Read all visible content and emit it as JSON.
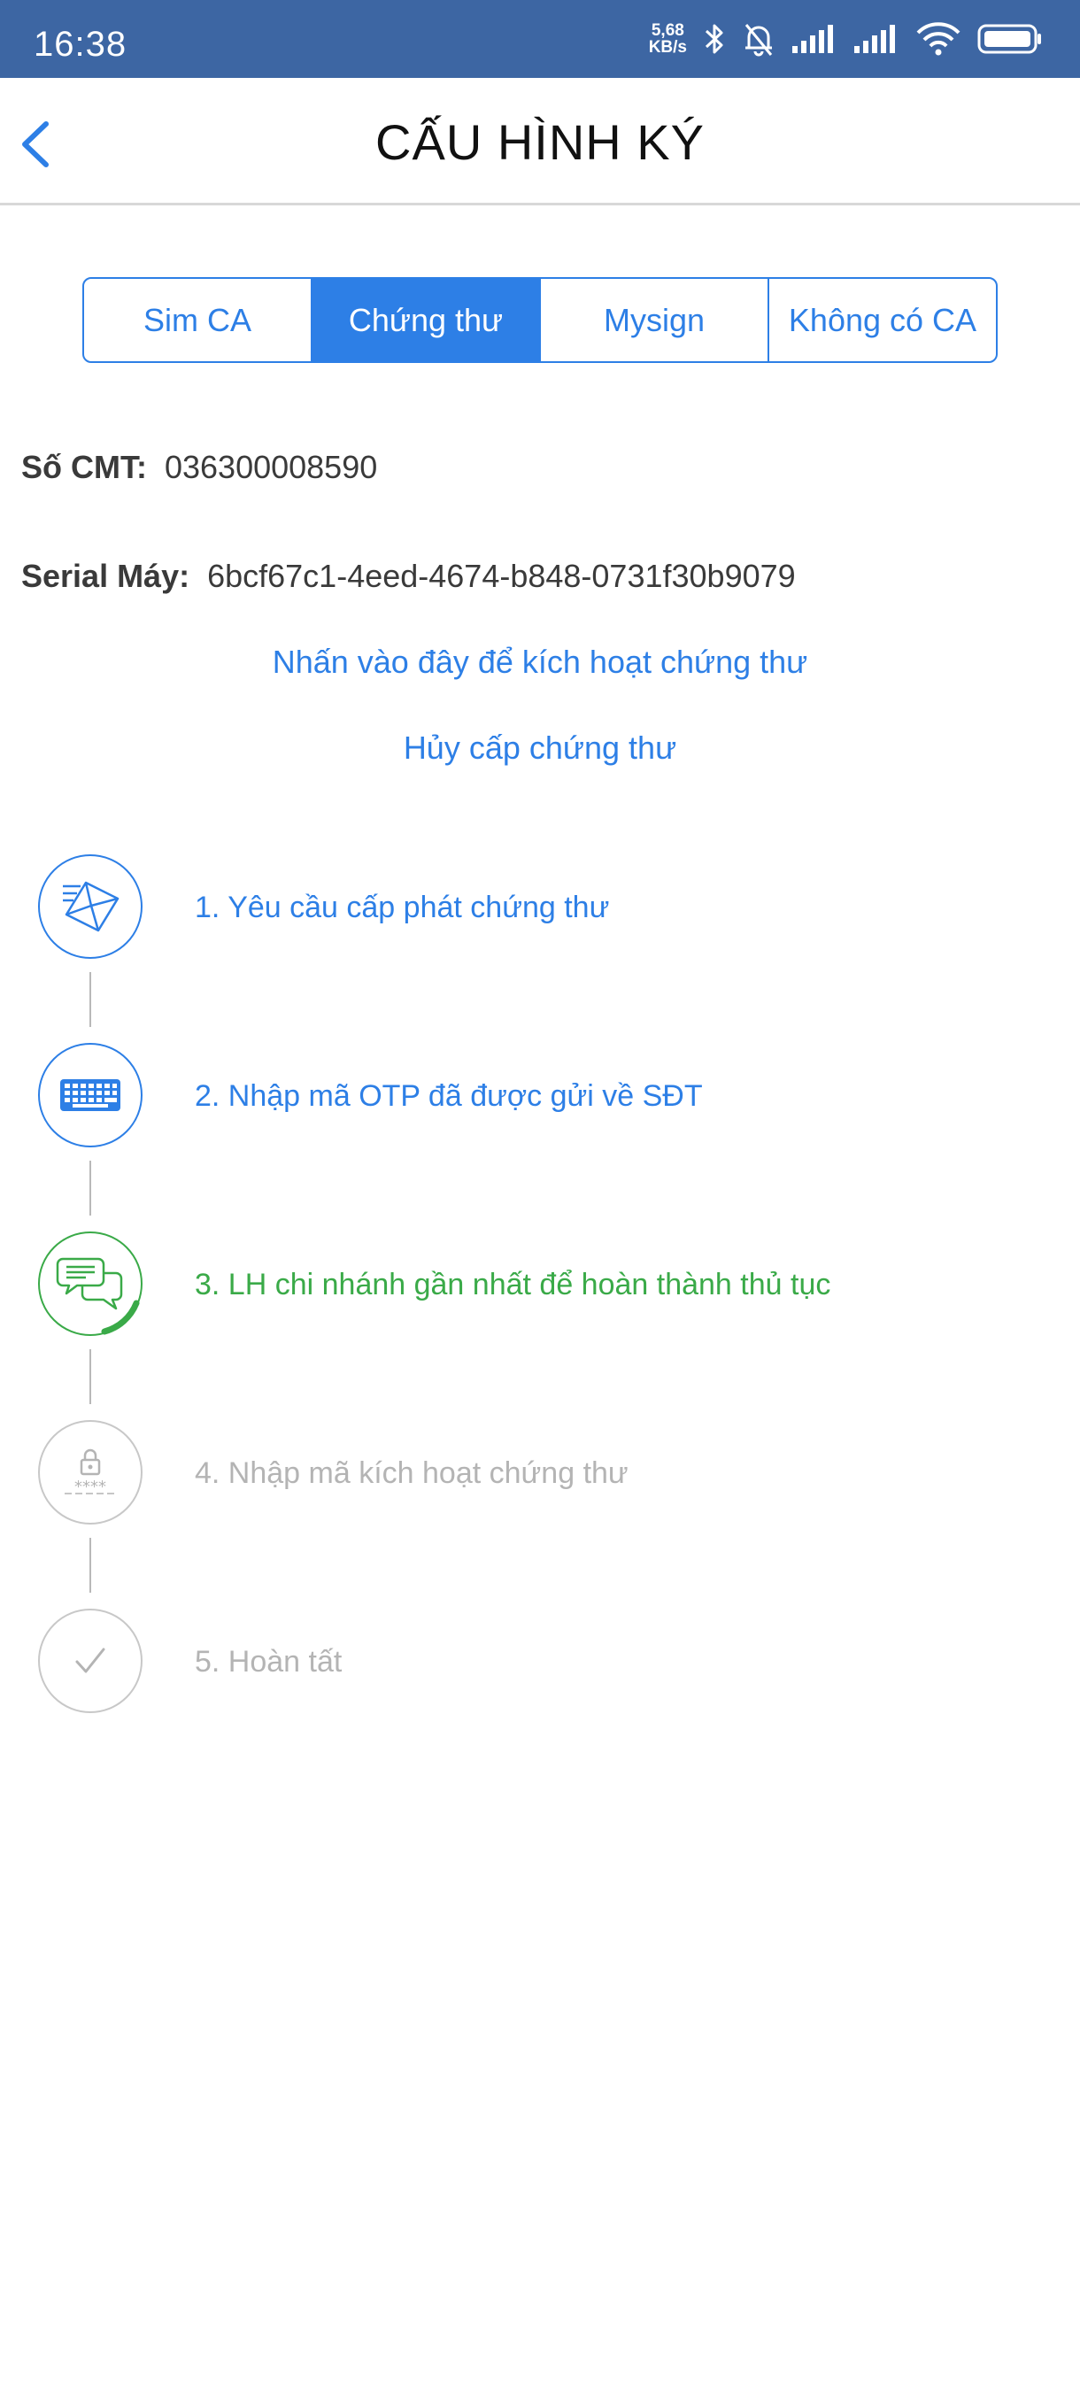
{
  "status_bar": {
    "time": "16:38",
    "net_speed_value": "5,68",
    "net_speed_unit": "KB/s",
    "icons": [
      "bluetooth-icon",
      "mute-bell-icon",
      "signal-icon",
      "signal-icon",
      "wifi-icon",
      "battery-icon"
    ]
  },
  "header": {
    "title": "CẤU HÌNH KÝ",
    "back_icon": "chevron-left-icon"
  },
  "tabs": [
    {
      "label": "Sim CA",
      "active": false
    },
    {
      "label": "Chứng thư",
      "active": true
    },
    {
      "label": "Mysign",
      "active": false
    },
    {
      "label": "Không có CA",
      "active": false
    }
  ],
  "info": {
    "cmt_label": "Số CMT:",
    "cmt_value": "036300008590",
    "serial_label": "Serial Máy:",
    "serial_value": "6bcf67c1-4eed-4674-b848-0731f30b9079"
  },
  "links": {
    "activate": "Nhấn vào đây để kích hoạt chứng thư",
    "revoke": "Hủy cấp chứng thư"
  },
  "steps": [
    {
      "label": "1. Yêu cầu cấp phát chứng thư",
      "icon": "envelope-icon",
      "state": "done"
    },
    {
      "label": "2. Nhập mã OTP đã được gửi về SĐT",
      "icon": "keyboard-icon",
      "state": "done"
    },
    {
      "label": "3. LH chi nhánh gần nhất để hoàn thành thủ tục",
      "icon": "chat-bubbles-icon",
      "state": "current"
    },
    {
      "label": "4. Nhập mã kích hoạt chứng thư",
      "icon": "lock-code-icon",
      "state": "pending"
    },
    {
      "label": "5. Hoàn tất",
      "icon": "checkmark-icon",
      "state": "pending"
    }
  ],
  "colors": {
    "status_bar": "#3d66a3",
    "accent_blue": "#2d7fe6",
    "current_green": "#3aaa48",
    "pending_gray": "#b4b4b4"
  }
}
